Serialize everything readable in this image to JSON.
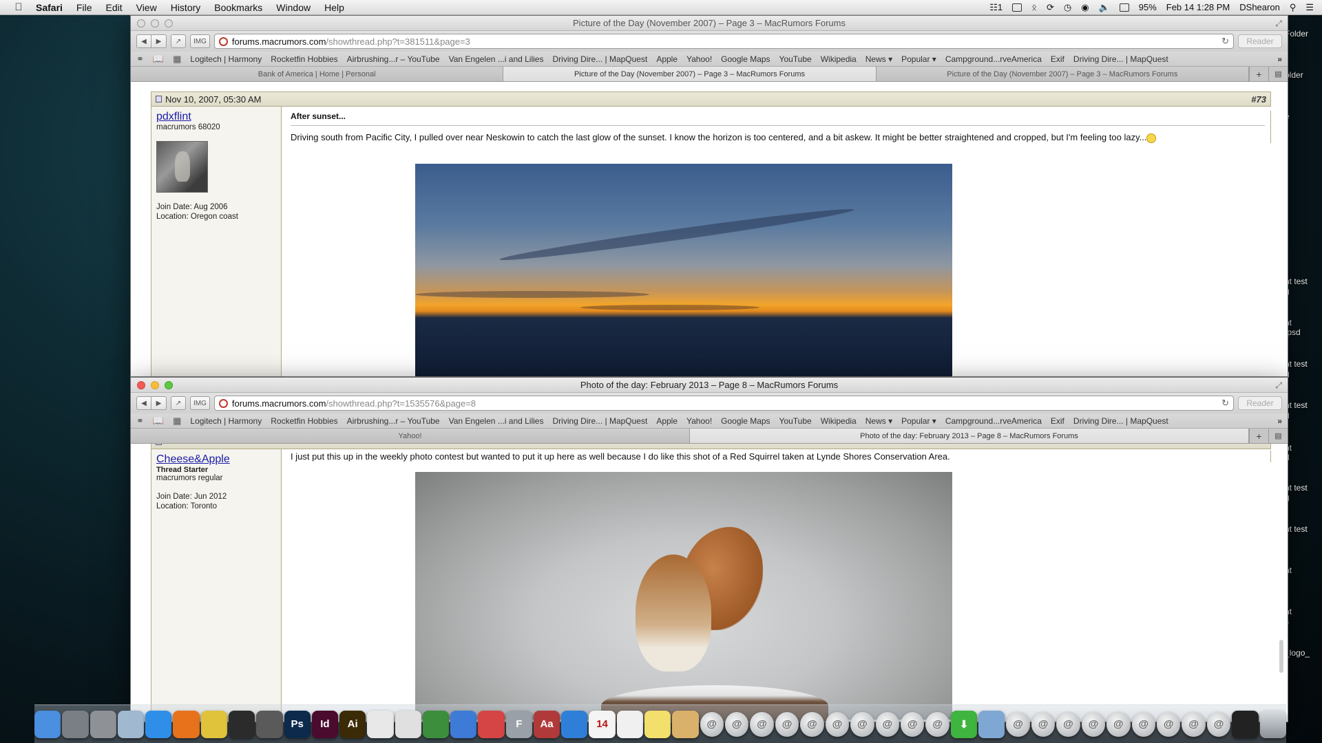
{
  "menubar": {
    "app": "Safari",
    "items": [
      "File",
      "Edit",
      "View",
      "History",
      "Bookmarks",
      "Window",
      "Help"
    ],
    "status": {
      "keyboard": "1",
      "battery": "95%",
      "datetime": "Feb 14  1:28 PM",
      "user": "DShearon"
    }
  },
  "desktop_labels": [
    "Folder",
    "older",
    "e",
    "ht test",
    "g",
    "ht",
    ".psd",
    "ht test",
    "g",
    "ht test",
    "g",
    "ht",
    "d",
    "ht test",
    "g",
    "ht test",
    "ht",
    "ht",
    "s",
    "_logo_"
  ],
  "bookmarks": [
    "Logitech | Harmony",
    "Rocketfin Hobbies",
    "Airbrushing...r – YouTube",
    "Van Engelen ...i and Lilies",
    "Driving Dire... | MapQuest",
    "Apple",
    "Yahoo!",
    "Google Maps",
    "YouTube",
    "Wikipedia",
    "News ▾",
    "Popular ▾",
    "Campground...rveAmerica",
    "Exif",
    "Driving Dire... | MapQuest"
  ],
  "window_back": {
    "title": "Picture of the Day (November 2007) – Page 3 – MacRumors Forums",
    "url_host": "forums.macrumors.com",
    "url_path": "/showthread.php?t=381511&page=3",
    "reader": "Reader",
    "tabs": [
      "Bank of America | Home | Personal",
      "Picture of the Day (November 2007) – Page 3 – MacRumors Forums",
      "Picture of the Day (November 2007) – Page 3 – MacRumors Forums"
    ],
    "post": {
      "date": "Nov 10, 2007, 05:30 AM",
      "number": "#73",
      "username": "pdxflint",
      "usertitle": "macrumors 68020",
      "join_date": "Join Date: Aug 2006",
      "location": "Location: Oregon coast",
      "title": "After sunset...",
      "body": "Driving south from Pacific City, I pulled over near Neskowin to catch the last glow of the sunset. I know the horizon is too centered, and a bit askew. It might be better straightened and cropped, but I'm feeling too lazy..."
    }
  },
  "window_front": {
    "title": "Photo of the day: February 2013 – Page 8 – MacRumors Forums",
    "url_host": "forums.macrumors.com",
    "url_path": "/showthread.php?t=1535576&page=8",
    "reader": "Reader",
    "tabs": [
      "Yahoo!",
      "Photo of the day: February 2013 – Page 8 – MacRumors Forums"
    ],
    "post": {
      "username": "Cheese&Apple",
      "thread_starter": "Thread Starter",
      "usertitle": "macrumors regular",
      "join_date": "Join Date: Jun 2012",
      "location": "Location: Toronto",
      "body": "I just put this up in the weekly photo contest but wanted to put it up here as well because I do like this shot of a Red Squirrel taken at Lynde Shores Conservation Area."
    }
  },
  "dock": [
    {
      "name": "finder-icon",
      "label": "",
      "color": "#4b8fe0"
    },
    {
      "name": "launchpad-icon",
      "label": "",
      "color": "#7a7f86"
    },
    {
      "name": "system-preferences-icon",
      "label": "",
      "color": "#8e9297"
    },
    {
      "name": "preview-icon",
      "label": "",
      "color": "#a0b8d0"
    },
    {
      "name": "safari-icon",
      "label": "",
      "color": "#2f8fe8"
    },
    {
      "name": "firefox-icon",
      "label": "",
      "color": "#e8721c"
    },
    {
      "name": "chrome-icon",
      "label": "",
      "color": "#e0c33a"
    },
    {
      "name": "aperture-icon",
      "label": "",
      "color": "#2b2b2b"
    },
    {
      "name": "camera-icon",
      "label": "",
      "color": "#5a5a5a"
    },
    {
      "name": "photoshop-icon",
      "label": "Ps",
      "color": "#0d2a4c"
    },
    {
      "name": "indesign-icon",
      "label": "Id",
      "color": "#4a0b2e"
    },
    {
      "name": "illustrator-icon",
      "label": "Ai",
      "color": "#3b2a06"
    },
    {
      "name": "acrobat-icon",
      "label": "",
      "color": "#e8e8e8"
    },
    {
      "name": "textedit-icon",
      "label": "",
      "color": "#e0e0e0"
    },
    {
      "name": "numbers-icon",
      "label": "",
      "color": "#3c8e3c"
    },
    {
      "name": "itunes-icon",
      "label": "",
      "color": "#3e7bd6"
    },
    {
      "name": "address-book-icon",
      "label": "",
      "color": "#d64545"
    },
    {
      "name": "fontbook-icon",
      "label": "F",
      "color": "#9aa0a8"
    },
    {
      "name": "dictionary-icon",
      "label": "Aa",
      "color": "#b03a3a"
    },
    {
      "name": "app-store-icon",
      "label": "",
      "color": "#2f7fd8"
    },
    {
      "name": "calendar-icon",
      "label": "14",
      "color": "#f4f4f4"
    },
    {
      "name": "reminders-icon",
      "label": "",
      "color": "#f0f0f0"
    },
    {
      "name": "notes-icon",
      "label": "",
      "color": "#f3df6b"
    },
    {
      "name": "stamp-icon",
      "label": "",
      "color": "#d9b16a"
    }
  ],
  "dock_right": {
    "at_count_left": 10,
    "download_label": "",
    "at_count_right": 9
  }
}
